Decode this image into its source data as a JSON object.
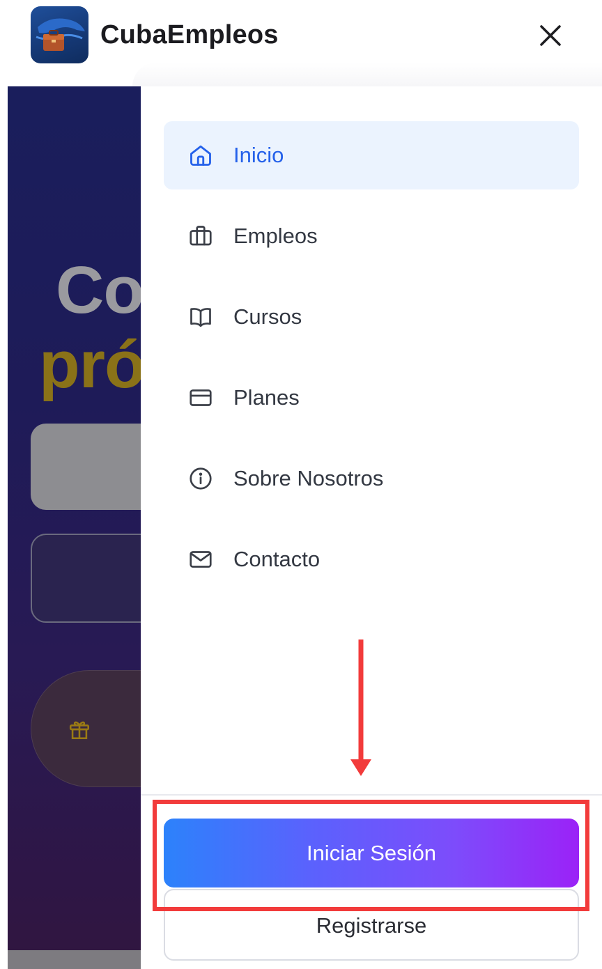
{
  "header": {
    "brand": "CubaEmpleos",
    "logo_icon": "cuba-briefcase-logo-icon",
    "close_icon": "close-icon"
  },
  "background_page": {
    "title_line1": "Co",
    "title_line2": "pró",
    "gift_icon": "gift-icon"
  },
  "drawer": {
    "nav": [
      {
        "label": "Inicio",
        "icon": "home-icon",
        "active": true
      },
      {
        "label": "Empleos",
        "icon": "briefcase-icon",
        "active": false
      },
      {
        "label": "Cursos",
        "icon": "book-open-icon",
        "active": false
      },
      {
        "label": "Planes",
        "icon": "credit-card-icon",
        "active": false
      },
      {
        "label": "Sobre Nosotros",
        "icon": "info-icon",
        "active": false
      },
      {
        "label": "Contacto",
        "icon": "mail-icon",
        "active": false
      }
    ],
    "login_label": "Iniciar Sesión",
    "register_label": "Registrarse"
  },
  "colors": {
    "active_nav_bg": "#ebf3fe",
    "active_nav_text": "#2561ea",
    "login_gradient_start": "#2c82fb",
    "login_gradient_end": "#9b22f7",
    "annotation_red": "#f23b3b"
  }
}
